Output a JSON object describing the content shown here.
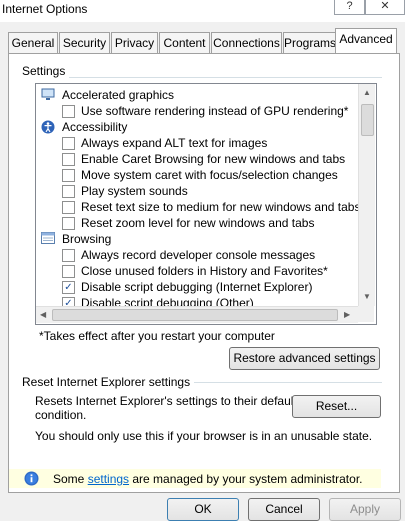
{
  "window": {
    "title": "Internet Options",
    "help_glyph": "?",
    "close_glyph": "✕"
  },
  "tabs": [
    "General",
    "Security",
    "Privacy",
    "Content",
    "Connections",
    "Programs",
    "Advanced"
  ],
  "active_tab": "Advanced",
  "settings": {
    "group_label": "Settings",
    "rows": [
      {
        "type": "category",
        "icon": "monitor-icon",
        "label": "Accelerated graphics"
      },
      {
        "type": "checkbox",
        "checked": false,
        "label": "Use software rendering instead of GPU rendering*"
      },
      {
        "type": "category",
        "icon": "accessibility-icon",
        "label": "Accessibility"
      },
      {
        "type": "checkbox",
        "checked": false,
        "label": "Always expand ALT text for images"
      },
      {
        "type": "checkbox",
        "checked": false,
        "label": "Enable Caret Browsing for new windows and tabs"
      },
      {
        "type": "checkbox",
        "checked": false,
        "label": "Move system caret with focus/selection changes"
      },
      {
        "type": "checkbox",
        "checked": false,
        "label": "Play system sounds"
      },
      {
        "type": "checkbox",
        "checked": false,
        "label": "Reset text size to medium for new windows and tabs"
      },
      {
        "type": "checkbox",
        "checked": false,
        "label": "Reset zoom level for new windows and tabs"
      },
      {
        "type": "category",
        "icon": "browsing-icon",
        "label": "Browsing"
      },
      {
        "type": "checkbox",
        "checked": false,
        "label": "Always record developer console messages"
      },
      {
        "type": "checkbox",
        "checked": false,
        "label": "Close unused folders in History and Favorites*"
      },
      {
        "type": "checkbox",
        "checked": true,
        "label": "Disable script debugging (Internet Explorer)"
      },
      {
        "type": "checkbox",
        "checked": true,
        "label": "Disable script debugging (Other)"
      }
    ],
    "footnote": "*Takes effect after you restart your computer",
    "restore_button": "Restore advanced settings"
  },
  "reset": {
    "group_label": "Reset Internet Explorer settings",
    "description_line1": "Resets Internet Explorer's settings to their default",
    "description_line2": "condition.",
    "reset_button": "Reset...",
    "warning": "You should only use this if your browser is in an unusable state."
  },
  "admin_notice": {
    "prefix": "Some ",
    "link": "settings",
    "suffix": " are managed by your system administrator."
  },
  "buttons": {
    "ok": "OK",
    "cancel": "Cancel",
    "apply": "Apply"
  }
}
